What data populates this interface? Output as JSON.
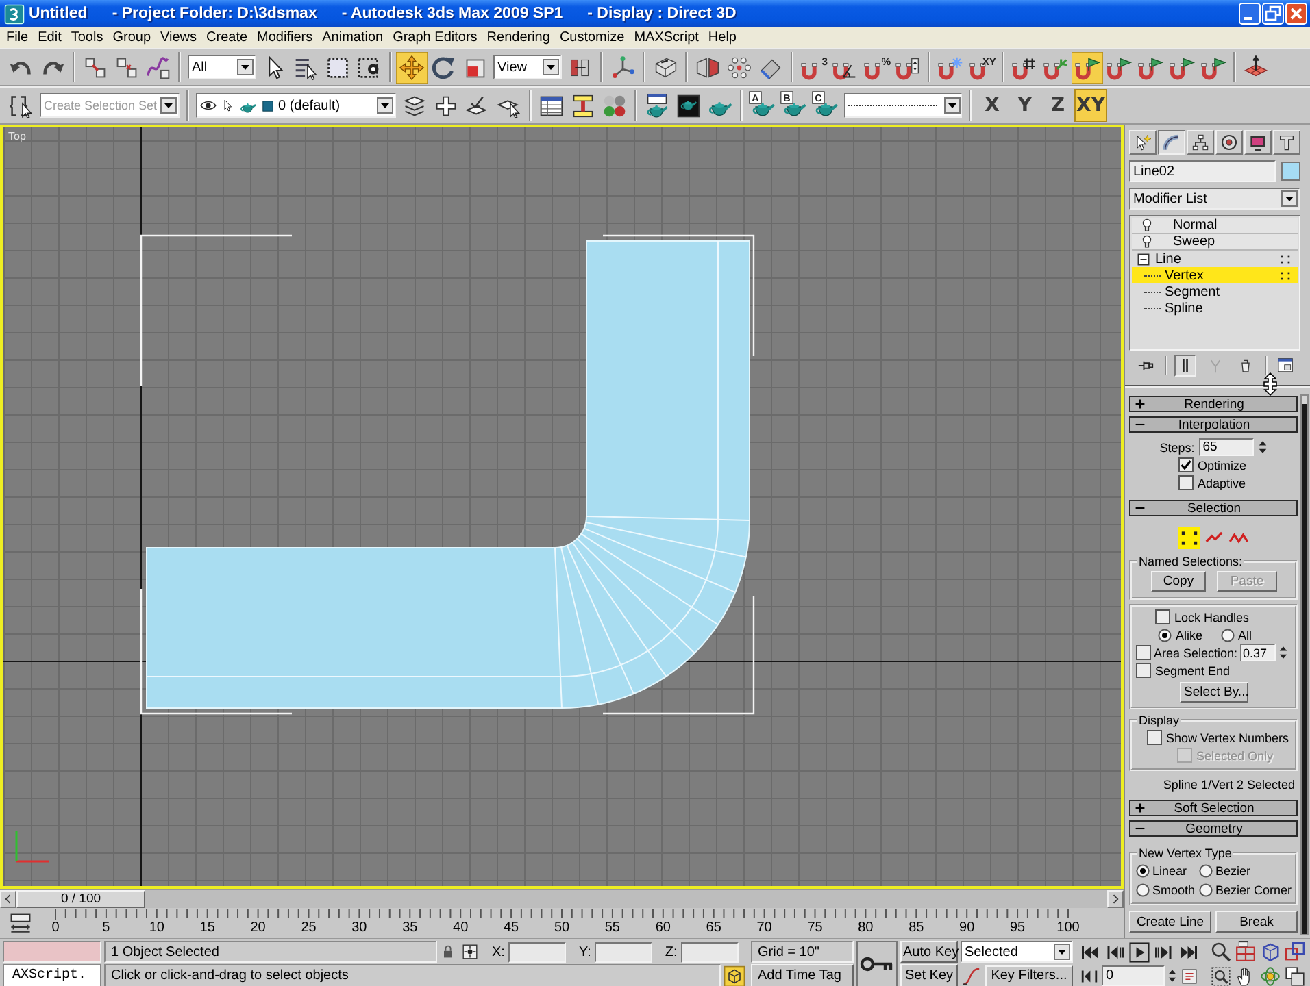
{
  "title_bar": {
    "segments": [
      "Untitled",
      "- Project Folder: D:\\3dsmax",
      "- Autodesk 3ds Max 2009 SP1",
      "- Display : Direct 3D"
    ]
  },
  "menu": [
    "File",
    "Edit",
    "Tools",
    "Group",
    "Views",
    "Create",
    "Modifiers",
    "Animation",
    "Graph Editors",
    "Rendering",
    "Customize",
    "MAXScript",
    "Help"
  ],
  "main_toolbar": [
    [
      {
        "kind": "button",
        "selected": false
      },
      {
        "kind": "button",
        "selected": false
      }
    ],
    [
      {
        "kind": "button",
        "selected": false
      },
      {
        "kind": "button",
        "selected": false
      },
      {
        "kind": "button",
        "selected": false
      }
    ],
    [
      {
        "kind": "dropdown",
        "value": "All"
      },
      {
        "kind": "button",
        "selected": false
      },
      {
        "kind": "button",
        "selected": false
      },
      {
        "kind": "button",
        "selected": false
      },
      {
        "kind": "button",
        "selected": false
      }
    ],
    [
      {
        "kind": "button",
        "selected": true
      },
      {
        "kind": "button",
        "selected": false
      },
      {
        "kind": "button",
        "selected": false
      },
      {
        "kind": "dropdown",
        "value": "View"
      },
      {
        "kind": "button",
        "selected": false
      }
    ],
    [
      {
        "kind": "button",
        "selected": false
      }
    ],
    [
      {
        "kind": "button",
        "selected": false
      }
    ],
    [
      {
        "kind": "button",
        "selected": false
      },
      {
        "kind": "button",
        "selected": false
      },
      {
        "kind": "button",
        "selected": false
      }
    ],
    [
      {
        "kind": "button",
        "selected": false,
        "glyph": "3"
      },
      {
        "kind": "button",
        "selected": false
      },
      {
        "kind": "button",
        "selected": false,
        "glyph": "%"
      },
      {
        "kind": "button",
        "selected": false
      }
    ],
    [
      {
        "kind": "button",
        "selected": false
      },
      {
        "kind": "button",
        "selected": false,
        "glyph": "XY"
      }
    ],
    [
      {
        "kind": "button",
        "selected": false
      },
      {
        "kind": "button",
        "selected": false
      },
      {
        "kind": "button",
        "selected": true
      },
      {
        "kind": "button",
        "selected": false
      },
      {
        "kind": "button",
        "selected": false
      },
      {
        "kind": "button",
        "selected": false
      },
      {
        "kind": "button",
        "selected": false
      }
    ],
    [
      {
        "kind": "button",
        "selected": false
      }
    ]
  ],
  "secondary_toolbar": [
    [
      {
        "kind": "button",
        "selected": false
      },
      {
        "kind": "dropdown",
        "placeholder": "Create Selection Set"
      }
    ],
    [
      {
        "kind": "layer",
        "value": "0 (default)"
      },
      {
        "kind": "button",
        "selected": false
      },
      {
        "kind": "button",
        "selected": false
      },
      {
        "kind": "button",
        "selected": false
      },
      {
        "kind": "button",
        "selected": false
      }
    ],
    [
      {
        "kind": "button",
        "selected": false
      },
      {
        "kind": "button",
        "selected": false
      },
      {
        "kind": "button",
        "selected": false
      }
    ],
    [
      {
        "kind": "button",
        "selected": false
      },
      {
        "kind": "button",
        "selected": false
      },
      {
        "kind": "button",
        "selected": false
      }
    ],
    [
      {
        "kind": "button",
        "selected": false,
        "glyph": "A"
      },
      {
        "kind": "button",
        "selected": false,
        "glyph": "B"
      },
      {
        "kind": "button",
        "selected": false,
        "glyph": "C"
      },
      {
        "kind": "linestyle"
      }
    ],
    [
      {
        "kind": "axis",
        "label": "X",
        "selected": false
      },
      {
        "kind": "axis",
        "label": "Y",
        "selected": false
      },
      {
        "kind": "axis",
        "label": "Z",
        "selected": false
      },
      {
        "kind": "axis",
        "label": "XY",
        "selected": true
      }
    ]
  ],
  "viewport": {
    "label": "Top",
    "active": true,
    "object": {
      "selected": true
    }
  },
  "time_slider": {
    "label": "0 / 100",
    "level": 0
  },
  "track_bar": {
    "ticks": [
      "0",
      "5",
      "10",
      "15",
      "20",
      "25",
      "30",
      "35",
      "40",
      "45",
      "50",
      "55",
      "60",
      "65",
      "70",
      "75",
      "80",
      "85",
      "90",
      "95",
      "100"
    ]
  },
  "command_panel": {
    "tabs": [
      {
        "selected": false
      },
      {
        "selected": true
      },
      {
        "selected": false
      },
      {
        "selected": false
      },
      {
        "selected": false
      },
      {
        "selected": false
      }
    ],
    "object_name": "Line02",
    "modifier_list": "Modifier List",
    "stack": [
      {
        "label": "Normal",
        "kind": "modifier",
        "on": true,
        "selected": false
      },
      {
        "label": "Sweep",
        "kind": "modifier",
        "on": true,
        "selected": false
      },
      {
        "label": "Line",
        "kind": "object",
        "expanded": true,
        "selected": false,
        "children": [
          {
            "label": "Vertex",
            "selected": true
          },
          {
            "label": "Segment",
            "selected": false
          },
          {
            "label": "Spline",
            "selected": false
          }
        ]
      }
    ],
    "stack_buttons": [
      {
        "pressed": false,
        "disabled": false
      },
      {
        "pressed": true,
        "disabled": false
      },
      {
        "pressed": false,
        "disabled": true
      },
      {
        "pressed": false,
        "disabled": false
      },
      {
        "pressed": false,
        "disabled": false
      }
    ],
    "rollouts": [
      {
        "title": "Rendering",
        "expanded": false
      },
      {
        "title": "Interpolation",
        "expanded": true,
        "kind": "interpolation",
        "steps_label": "Steps:",
        "steps": "65",
        "checks": [
          {
            "label": "Optimize",
            "checked": true
          },
          {
            "label": "Adaptive",
            "checked": false
          }
        ]
      },
      {
        "title": "Selection",
        "expanded": true,
        "kind": "selection",
        "levels": [
          {
            "selected": true
          },
          {
            "selected": false
          },
          {
            "selected": false
          }
        ],
        "named_title": "Named Selections:",
        "named_buttons": [
          {
            "label": "Copy",
            "disabled": false
          },
          {
            "label": "Paste",
            "disabled": true
          }
        ],
        "lock_handles": {
          "label": "Lock Handles",
          "checked": false
        },
        "lock_mode": [
          {
            "label": "Alike",
            "selected": true
          },
          {
            "label": "All",
            "selected": false
          }
        ],
        "area_selection": {
          "label": "Area Selection:",
          "checked": false,
          "value": "0.37"
        },
        "segment_end": {
          "label": "Segment End",
          "checked": false
        },
        "select_by": "Select By...",
        "display_title": "Display",
        "show_vertex_numbers": {
          "label": "Show Vertex Numbers",
          "checked": false
        },
        "selected_only": {
          "label": "Selected Only",
          "checked": false,
          "disabled": true
        },
        "info": "Spline 1/Vert 2 Selected"
      },
      {
        "title": "Soft Selection",
        "expanded": false
      },
      {
        "title": "Geometry",
        "expanded": true,
        "kind": "geometry",
        "vertex_type_title": "New Vertex Type",
        "vertex_types": [
          {
            "label": "Linear",
            "selected": true
          },
          {
            "label": "Bezier",
            "selected": false
          },
          {
            "label": "Smooth",
            "selected": false
          },
          {
            "label": "Bezier Corner",
            "selected": false
          }
        ],
        "buttons": [
          "Create Line",
          "Break"
        ]
      }
    ]
  },
  "status_bar": {
    "listener": "AXScript.",
    "selection_info": "1 Object Selected",
    "prompt": "Click or click-and-drag to select objects",
    "coords": [
      {
        "label": "X:"
      },
      {
        "label": "Y:"
      },
      {
        "label": "Z:"
      }
    ],
    "grid": "Grid = 10\"",
    "time_tag": "Add Time Tag",
    "auto_key": {
      "label": "Auto Key",
      "on": false
    },
    "set_key": "Set Key",
    "key_set": "Selected",
    "key_filters": "Key Filters...",
    "frame": "0"
  }
}
